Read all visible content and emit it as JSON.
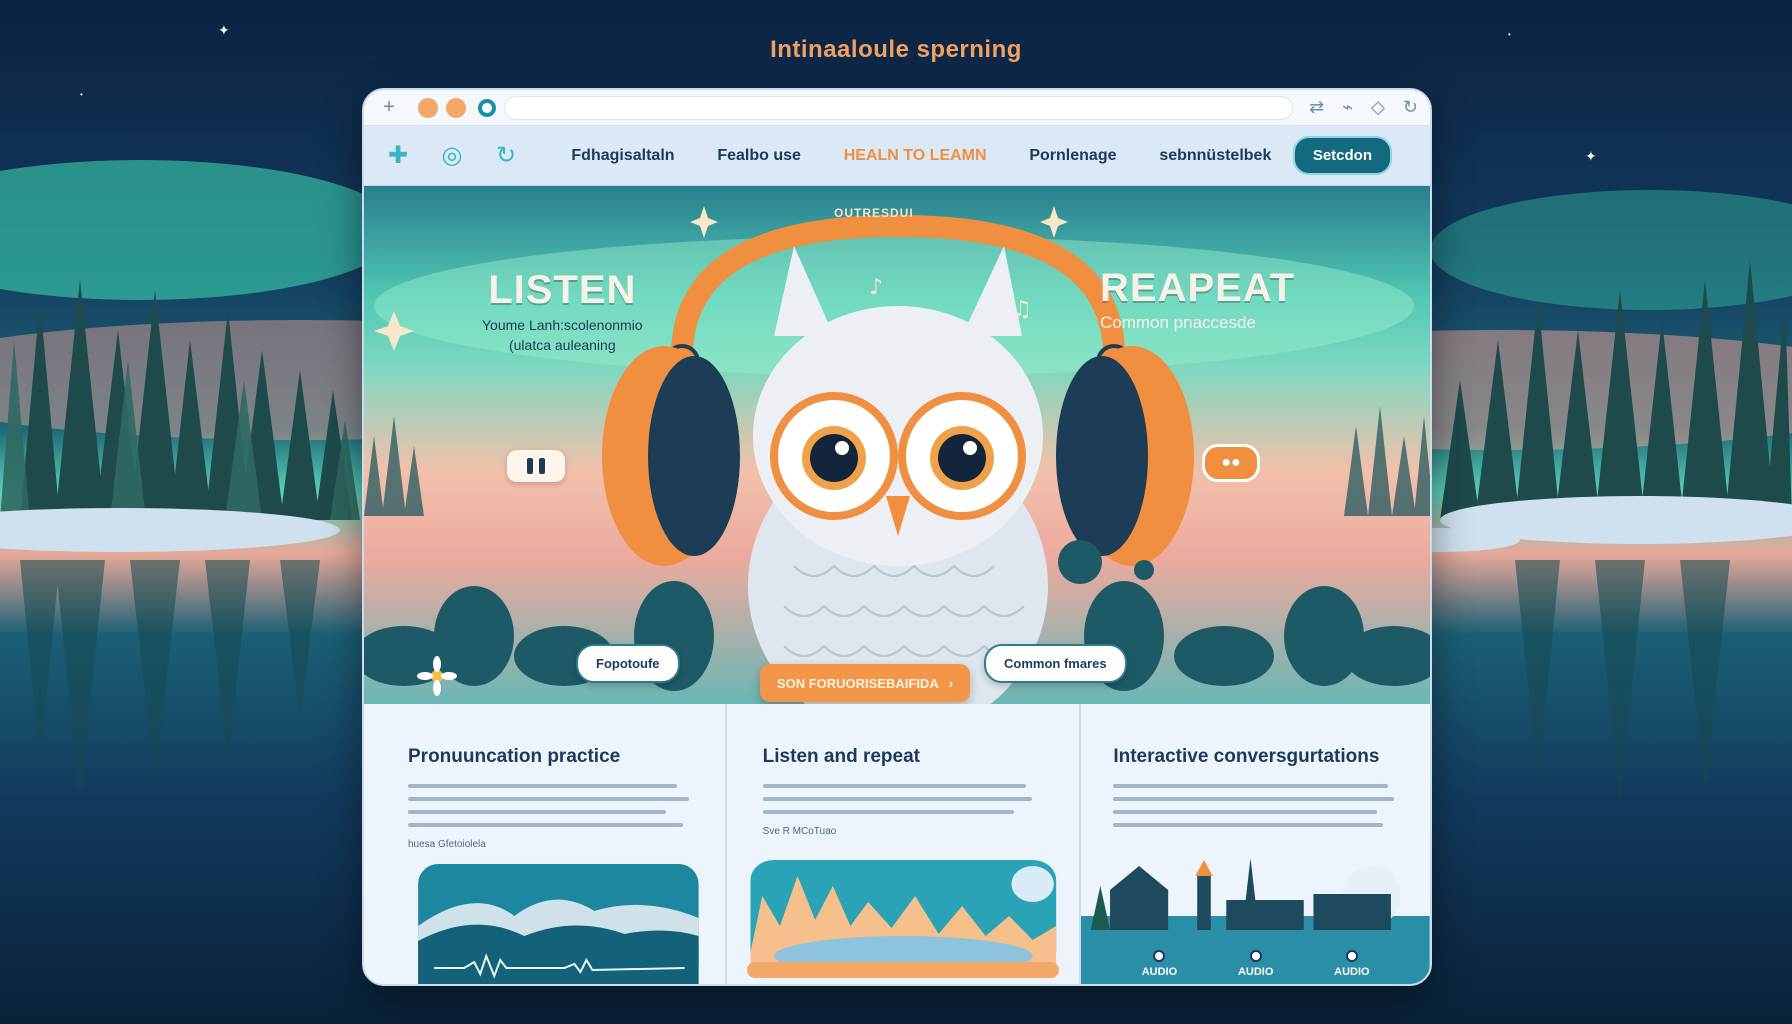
{
  "page": {
    "heading": "Intinaaloule sperning"
  },
  "browser": {
    "tab_plus_icon": "plus-icon",
    "toolbar_icons": [
      "shuffle-icon",
      "link-icon",
      "eraser-icon",
      "refresh-icon"
    ]
  },
  "nav": {
    "icons": [
      "plus-icon",
      "target-icon",
      "refresh-icon"
    ],
    "links": [
      {
        "label": "Fdhagisaltaln",
        "active": false
      },
      {
        "label": "Fealbo use",
        "active": false
      },
      {
        "label": "HEALN TO LEAMN",
        "active": true
      },
      {
        "label": "Pornlenage",
        "active": false
      },
      {
        "label": "sebnnüstelbek",
        "active": false
      }
    ],
    "cta_label": "Setcdon"
  },
  "hero": {
    "arc_label": "OUTRESDUI",
    "left_word": "LISTEN",
    "left_sub_1": "Youme Lanh:scolenonmio",
    "left_sub_2": "(ulatca auleaning",
    "right_word": "REAPEAT",
    "right_sub": "Common pnaccesde",
    "pill_left": "Fopotoufe",
    "pill_right": "Common fmares",
    "cta_label": "SON FORUORISEBAIFIDA",
    "cta_arrow": "›"
  },
  "cards": [
    {
      "title": "Pronuuncation practice",
      "note": "huesa Gfetoiolela"
    },
    {
      "title": "Listen and repeat",
      "note": "Sve R MCoTuao"
    },
    {
      "title": "Interactive conversgurtations",
      "note": ""
    }
  ],
  "audio": {
    "labels": [
      "AUDIO",
      "AUDIO",
      "AUDIO"
    ]
  },
  "colors": {
    "accent_orange": "#f08f40",
    "nav_text": "#1c3a5c",
    "cta_teal": "#13697e"
  }
}
